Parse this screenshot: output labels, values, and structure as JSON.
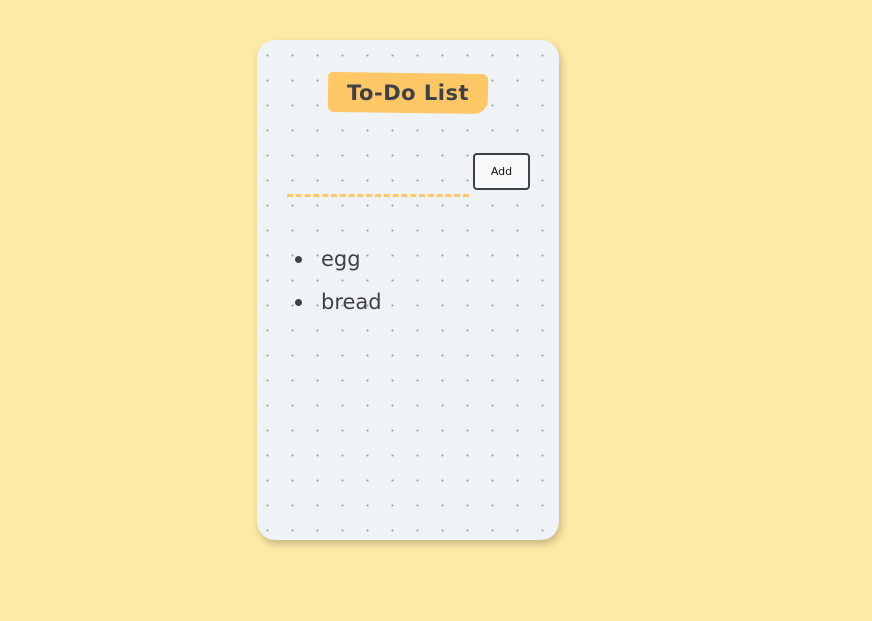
{
  "app": {
    "title": "To-Do List"
  },
  "form": {
    "input_value": "",
    "input_placeholder": "",
    "add_label": "Add"
  },
  "tasks": [
    {
      "label": "egg"
    },
    {
      "label": "bread"
    }
  ],
  "colors": {
    "page_background": "#FFE9A6",
    "card_background": "#F0F3F6",
    "accent": "#FFC766",
    "text": "#3E4147"
  }
}
